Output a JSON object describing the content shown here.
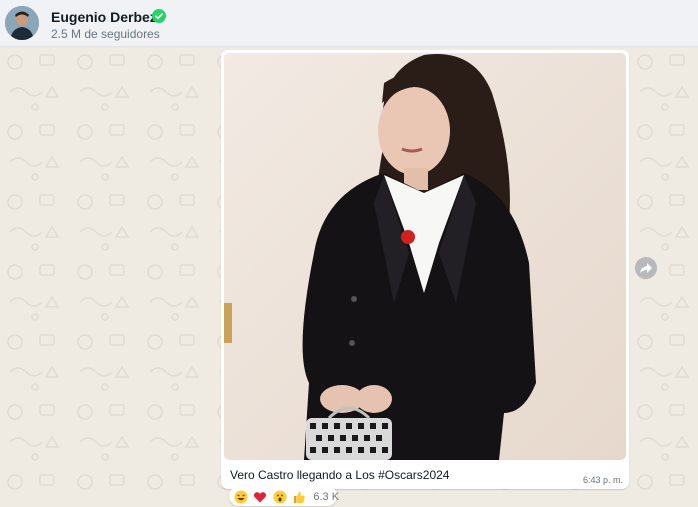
{
  "header": {
    "name": "Eugenio Derbez",
    "followers": "2.5 M de seguidores",
    "verified_icon": "verified-check-icon"
  },
  "message": {
    "caption": "Vero Castro llegando a Los #Oscars2024",
    "time": "6:43 p. m."
  },
  "reactions": {
    "emojis": [
      "laughing-face",
      "red-heart",
      "surprised-face",
      "thumbs-up"
    ],
    "count": "6.3 K"
  },
  "colors": {
    "header_bg": "#f0f2f5",
    "chat_bg": "#efeae2",
    "verified": "#25d366",
    "bubble": "#ffffff"
  }
}
